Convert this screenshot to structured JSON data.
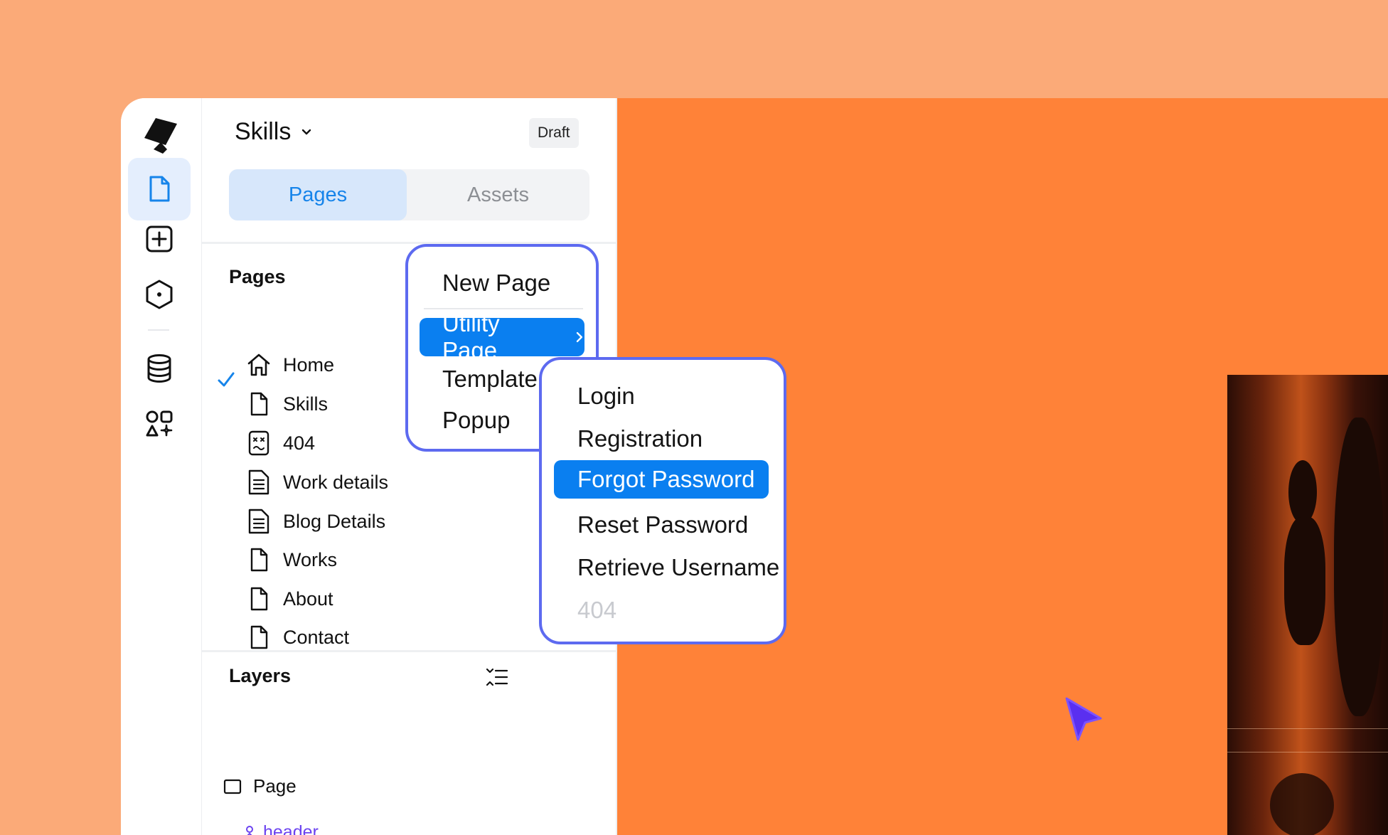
{
  "project": {
    "name": "Skills",
    "status": "Draft"
  },
  "tabs": {
    "pages": "Pages",
    "assets": "Assets"
  },
  "pages_section": {
    "title": "Pages",
    "items": [
      {
        "label": "Home",
        "icon": "home-icon"
      },
      {
        "label": "Skills",
        "icon": "page-icon",
        "selected": true
      },
      {
        "label": "404",
        "icon": "error-page-icon"
      },
      {
        "label": "Work details",
        "icon": "text-page-icon"
      },
      {
        "label": "Blog Details",
        "icon": "text-page-icon"
      },
      {
        "label": "Works",
        "icon": "page-icon"
      },
      {
        "label": "About",
        "icon": "page-icon"
      },
      {
        "label": "Contact",
        "icon": "page-icon"
      }
    ]
  },
  "layers_section": {
    "title": "Layers",
    "root": "Page",
    "child": "header"
  },
  "add_menu": {
    "new_page": "New Page",
    "utility_page": "Utility Page",
    "template": "Template",
    "popup": "Popup"
  },
  "utility_submenu": {
    "items": [
      "Login",
      "Registration",
      "Forgot Password",
      "Reset Password",
      "Retrieve Username",
      "404"
    ],
    "highlighted": "Forgot Password",
    "disabled": "404"
  },
  "colors": {
    "accent": "#0a7ff0",
    "outline": "#5d6af0",
    "canvas": "#ff8238",
    "background": "#fbaa78"
  }
}
